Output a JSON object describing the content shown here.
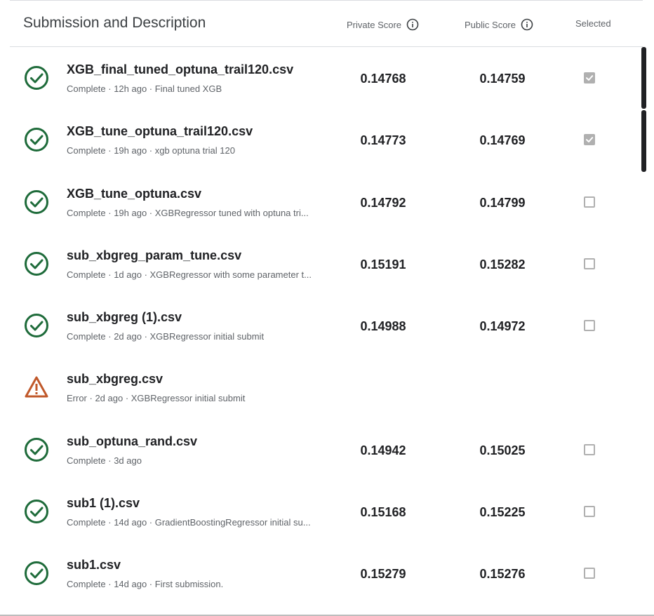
{
  "header": {
    "title": "Submission and Description",
    "private_score_label": "Private Score",
    "public_score_label": "Public Score",
    "selected_label": "Selected",
    "info_icon": "info-icon"
  },
  "colors": {
    "success": "#1e6b3a",
    "error": "#c0582a",
    "checkbox": "#b0b0b0"
  },
  "submissions": [
    {
      "status": "complete",
      "icon": "check-circle-icon",
      "name": "XGB_final_tuned_optuna_trail120.csv",
      "meta": "Complete · 12h ago · Final tuned XGB",
      "private": "0.14768",
      "public": "0.14759",
      "selected": true
    },
    {
      "status": "complete",
      "icon": "check-circle-icon",
      "name": "XGB_tune_optuna_trail120.csv",
      "meta": "Complete · 19h ago · xgb optuna trial 120",
      "private": "0.14773",
      "public": "0.14769",
      "selected": true
    },
    {
      "status": "complete",
      "icon": "check-circle-icon",
      "name": "XGB_tune_optuna.csv",
      "meta": "Complete · 19h ago · XGBRegressor tuned with optuna tri...",
      "private": "0.14792",
      "public": "0.14799",
      "selected": false
    },
    {
      "status": "complete",
      "icon": "check-circle-icon",
      "name": "sub_xbgreg_param_tune.csv",
      "meta": "Complete · 1d ago · XGBRegressor with some parameter t...",
      "private": "0.15191",
      "public": "0.15282",
      "selected": false
    },
    {
      "status": "complete",
      "icon": "check-circle-icon",
      "name": "sub_xbgreg (1).csv",
      "meta": "Complete · 2d ago · XGBRegressor initial submit",
      "private": "0.14988",
      "public": "0.14972",
      "selected": false
    },
    {
      "status": "error",
      "icon": "warning-icon",
      "name": "sub_xbgreg.csv",
      "meta": "Error · 2d ago · XGBRegressor initial submit",
      "private": "",
      "public": "",
      "selected": null
    },
    {
      "status": "complete",
      "icon": "check-circle-icon",
      "name": "sub_optuna_rand.csv",
      "meta": "Complete · 3d ago",
      "private": "0.14942",
      "public": "0.15025",
      "selected": false
    },
    {
      "status": "complete",
      "icon": "check-circle-icon",
      "name": "sub1 (1).csv",
      "meta": "Complete · 14d ago · GradientBoostingRegressor initial su...",
      "private": "0.15168",
      "public": "0.15225",
      "selected": false
    },
    {
      "status": "complete",
      "icon": "check-circle-icon",
      "name": "sub1.csv",
      "meta": "Complete · 14d ago · First submission.",
      "private": "0.15279",
      "public": "0.15276",
      "selected": false
    }
  ]
}
